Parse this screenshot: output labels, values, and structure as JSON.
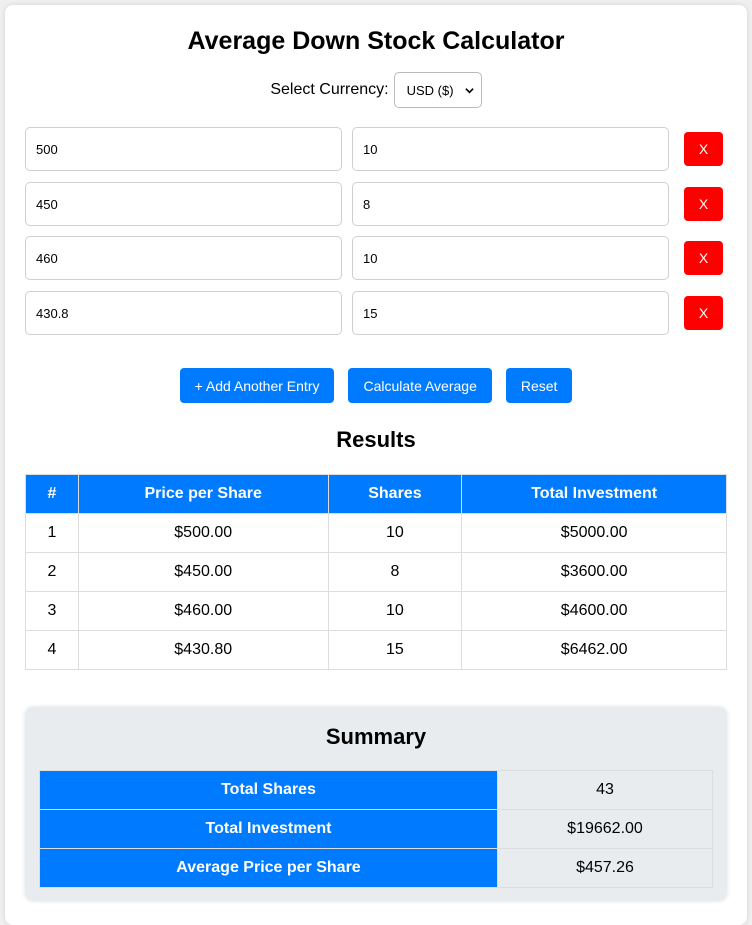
{
  "page": {
    "title": "Average Down Stock Calculator"
  },
  "currency": {
    "label": "Select Currency:",
    "selected": "USD ($)"
  },
  "entries": [
    {
      "price": "500",
      "shares": "10",
      "remove_label": "X"
    },
    {
      "price": "450",
      "shares": "8",
      "remove_label": "X"
    },
    {
      "price": "460",
      "shares": "10",
      "remove_label": "X"
    },
    {
      "price": "430.8",
      "shares": "15",
      "remove_label": "X"
    }
  ],
  "actions": {
    "add_label": "+ Add Another Entry",
    "calculate_label": "Calculate Average",
    "reset_label": "Reset"
  },
  "results": {
    "title": "Results",
    "headers": [
      "#",
      "Price per Share",
      "Shares",
      "Total Investment"
    ],
    "rows": [
      [
        "1",
        "$500.00",
        "10",
        "$5000.00"
      ],
      [
        "2",
        "$450.00",
        "8",
        "$3600.00"
      ],
      [
        "3",
        "$460.00",
        "10",
        "$4600.00"
      ],
      [
        "4",
        "$430.80",
        "15",
        "$6462.00"
      ]
    ]
  },
  "summary": {
    "title": "Summary",
    "rows": [
      {
        "label": "Total Shares",
        "value": "43"
      },
      {
        "label": "Total Investment",
        "value": "$19662.00"
      },
      {
        "label": "Average Price per Share",
        "value": "$457.26"
      }
    ]
  },
  "colors": {
    "primary": "#007bff",
    "danger": "#ff0000",
    "summary_bg": "#e9ecef"
  }
}
